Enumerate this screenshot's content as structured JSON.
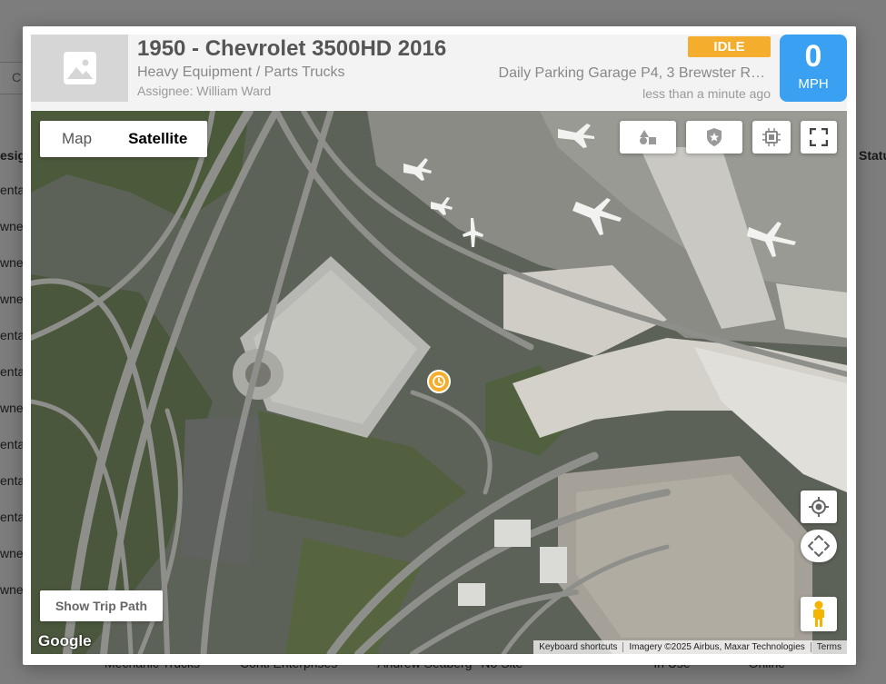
{
  "background": {
    "search_letter": "C",
    "col_left": "esig",
    "col_right": "Statu",
    "rows": [
      "enta",
      "wne",
      "wne",
      "wne",
      "enta",
      "enta",
      "wne",
      "enta",
      "enta",
      "enta",
      "wne",
      "wne"
    ],
    "bottom_row": {
      "category": "Mechanic Trucks",
      "company": "Conti Enterprises",
      "assignee": "Andrew Seaberg",
      "site": "No Site",
      "status": "In Use",
      "online": "Online"
    }
  },
  "asset": {
    "title": "1950 - Chevrolet 3500HD 2016",
    "category": "Heavy Equipment / Parts Trucks",
    "assignee_label": "Assignee: ",
    "assignee_name": "William Ward",
    "status": "IDLE",
    "location": "Daily Parking Garage P4, 3 Brewster R…",
    "last_update": "less than a minute ago",
    "speed": "0",
    "speed_unit": "MPH"
  },
  "map": {
    "type_options": [
      "Map",
      "Satellite"
    ],
    "active_type": "Satellite",
    "trip_button": "Show Trip Path",
    "logo": "Google",
    "attribution": [
      "Keyboard shortcuts",
      "Imagery ©2025 Airbus, Maxar Technologies",
      "Terms"
    ],
    "controls": [
      "layers-icon",
      "shield-icon",
      "chip-icon",
      "fullscreen-icon",
      "locate-icon",
      "pan-icon",
      "pegman-icon"
    ]
  },
  "colors": {
    "status_idle": "#f5ad2d",
    "speed_box": "#3aa1f2"
  }
}
